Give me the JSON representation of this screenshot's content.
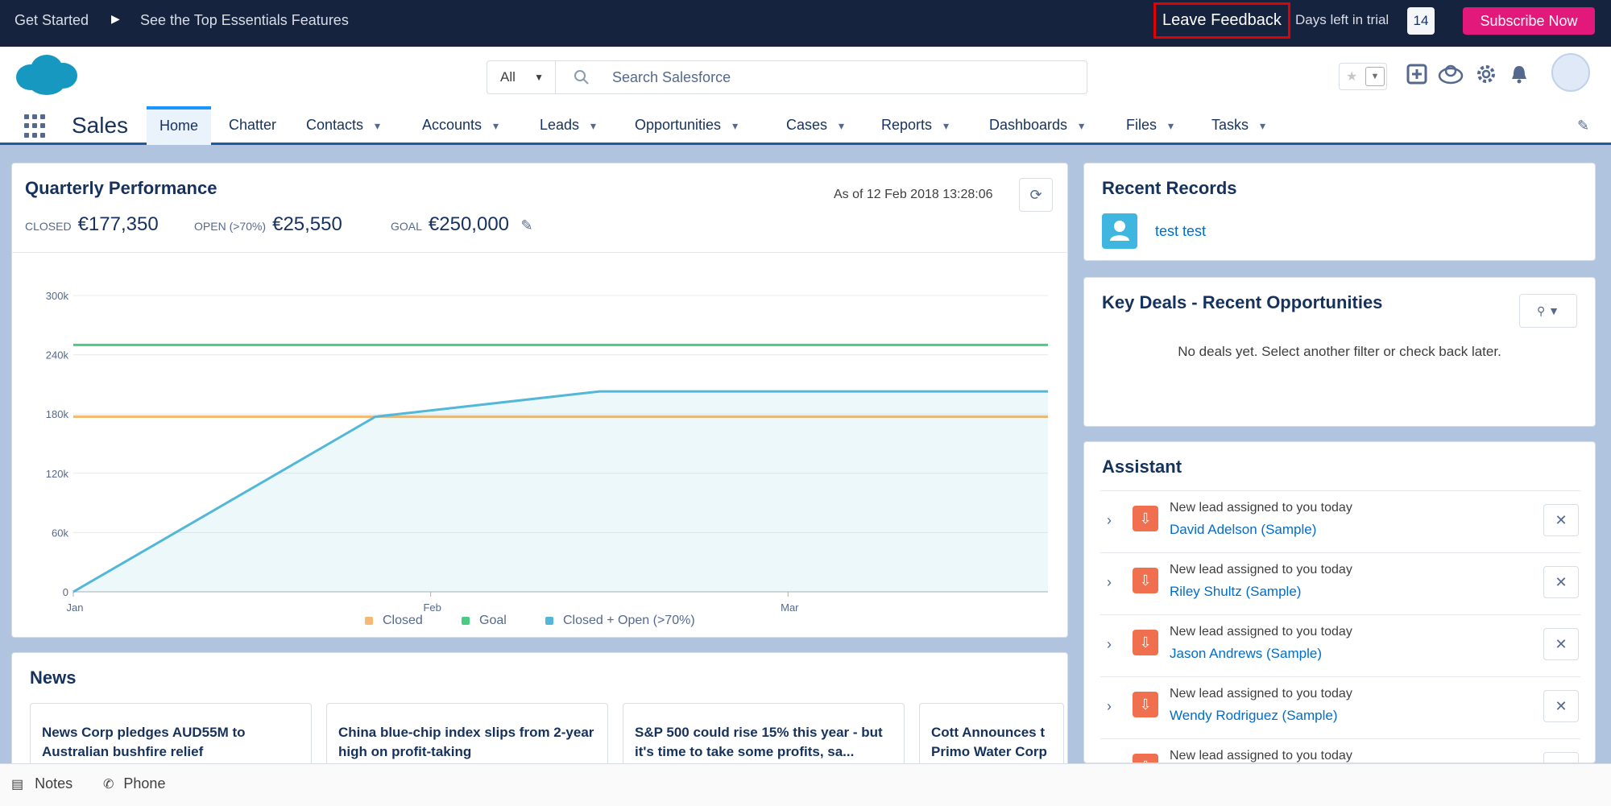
{
  "trial_bar": {
    "get_started": "Get Started",
    "essentials": "See the Top Essentials Features",
    "leave_feedback": "Leave Feedback",
    "days_left_label": "Days left in trial",
    "days_left": "14",
    "subscribe": "Subscribe Now"
  },
  "header": {
    "search_scope": "All",
    "search_placeholder": "Search Salesforce"
  },
  "nav": {
    "app_name": "Sales",
    "items": [
      {
        "label": "Home"
      },
      {
        "label": "Chatter"
      },
      {
        "label": "Contacts"
      },
      {
        "label": "Accounts"
      },
      {
        "label": "Leads"
      },
      {
        "label": "Opportunities"
      },
      {
        "label": "Cases"
      },
      {
        "label": "Reports"
      },
      {
        "label": "Dashboards"
      },
      {
        "label": "Files"
      },
      {
        "label": "Tasks"
      }
    ]
  },
  "quarterly": {
    "title": "Quarterly Performance",
    "as_of": "As of 12 Feb 2018 13:28:06",
    "closed_label": "CLOSED",
    "closed_value": "€177,350",
    "open_label": "OPEN (>70%)",
    "open_value": "€25,550",
    "goal_label": "GOAL",
    "goal_value": "€250,000",
    "legend": [
      "Closed",
      "Goal",
      "Closed + Open (>70%)"
    ]
  },
  "chart_data": {
    "type": "line",
    "x_ticks": [
      "Jan",
      "Feb",
      "Mar"
    ],
    "y_ticks": [
      "0",
      "60k",
      "120k",
      "180k",
      "240k",
      "300k"
    ],
    "ylim": [
      0,
      300000
    ],
    "series": [
      {
        "name": "Closed",
        "color": "#f5b971",
        "points": [
          [
            0.0,
            177350
          ],
          [
            1.0,
            177350
          ]
        ]
      },
      {
        "name": "Goal",
        "color": "#4bca81",
        "points": [
          [
            0.0,
            250000
          ],
          [
            1.0,
            250000
          ]
        ]
      },
      {
        "name": "Closed + Open (>70%)",
        "color": "#52b7d8",
        "area": true,
        "points": [
          [
            0.0,
            0
          ],
          [
            0.31,
            177350
          ],
          [
            0.54,
            202900
          ],
          [
            1.0,
            202900
          ]
        ]
      }
    ]
  },
  "news": {
    "title": "News",
    "items": [
      "News Corp pledges AUD55M to Australian bushfire relief",
      "China blue-chip index slips from 2-year high on profit-taking",
      "S&P 500 could rise 15% this year - but it's time to take some profits, sa...",
      "Cott Announces t Primo Water Corp"
    ]
  },
  "recent_records": {
    "title": "Recent Records",
    "items": [
      "test test"
    ]
  },
  "key_deals": {
    "title": "Key Deals - Recent Opportunities",
    "empty": "No deals yet. Select another filter or check back later."
  },
  "assistant": {
    "title": "Assistant",
    "items": [
      {
        "message": "New lead assigned to you today",
        "name": "David Adelson (Sample)"
      },
      {
        "message": "New lead assigned to you today",
        "name": "Riley Shultz (Sample)"
      },
      {
        "message": "New lead assigned to you today",
        "name": "Jason Andrews (Sample)"
      },
      {
        "message": "New lead assigned to you today",
        "name": "Wendy Rodriguez (Sample)"
      },
      {
        "message": "New lead assigned to you today",
        "name": ""
      }
    ]
  },
  "utility_bar": {
    "notes": "Notes",
    "phone": "Phone"
  }
}
